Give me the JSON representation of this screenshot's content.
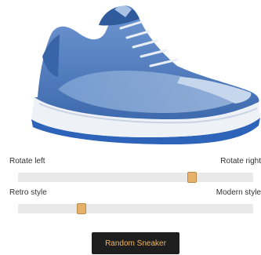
{
  "sliders": [
    {
      "left_label": "Rotate left",
      "right_label": "Rotate right",
      "value": 0.75
    },
    {
      "left_label": "Retro style",
      "right_label": "Modern style",
      "value": 0.26
    }
  ],
  "random_button": {
    "label": "Random Sneaker"
  },
  "colors": {
    "slider_thumb": "#e6b169",
    "slider_track": "#e9e9e9",
    "button_bg": "#1e1e1e",
    "button_text": "#f2b562",
    "sneaker_upper": "#4f7bbf",
    "sneaker_sole": "#eef1f6"
  }
}
